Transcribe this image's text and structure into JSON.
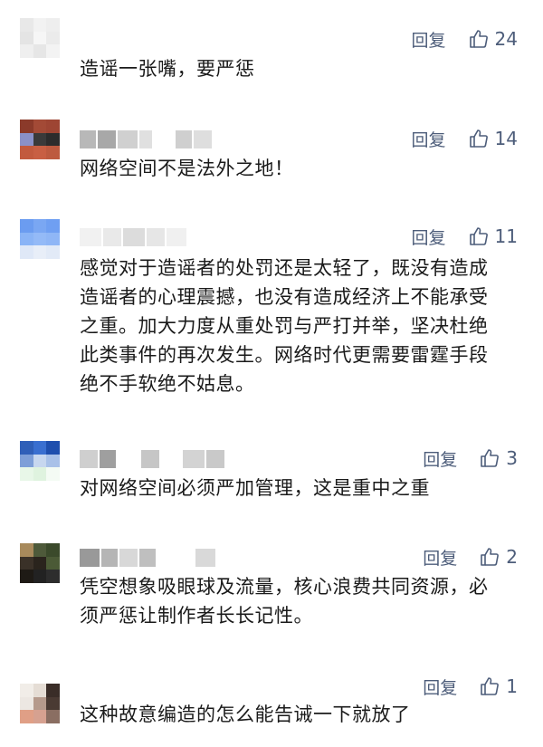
{
  "comments": [
    {
      "reply_label": "回复",
      "likes": "24",
      "text": "造谣一张嘴，要严惩"
    },
    {
      "reply_label": "回复",
      "likes": "14",
      "text": "网络空间不是法外之地！"
    },
    {
      "reply_label": "回复",
      "likes": "11",
      "text": "感觉对于造谣者的处罚还是太轻了，既没有造成造谣者的心理震撼，也没有造成经济上不能承受之重。加大力度从重处罚与严打并举，坚决杜绝此类事件的再次发生。网络时代更需要雷霆手段绝不手软绝不姑息。"
    },
    {
      "reply_label": "回复",
      "likes": "3",
      "text": "对网络空间必须严加管理，这是重中之重"
    },
    {
      "reply_label": "回复",
      "likes": "2",
      "text": "凭空想象吸眼球及流量，核心浪费共同资源，必须严惩让制作者长长记性。"
    },
    {
      "reply_label": "回复",
      "likes": "1",
      "text": "这种故意编造的怎么能告诫一下就放了"
    }
  ],
  "icons": {
    "like": "thumbs-up-icon"
  },
  "colors": {
    "action": "#4d5d7a",
    "text": "#1a1a1a"
  }
}
